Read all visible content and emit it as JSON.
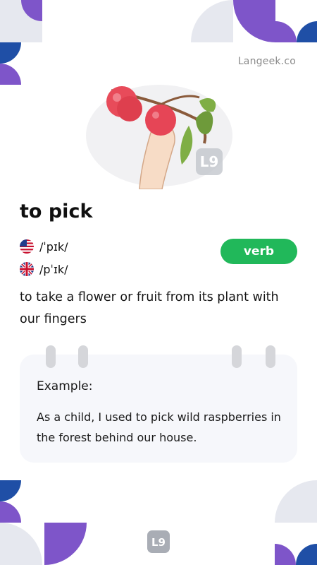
{
  "brand": {
    "site": "Langeek.co"
  },
  "entry": {
    "word": "to pick",
    "pronunciations": [
      {
        "region": "US",
        "flag_icon": "us-flag-icon",
        "ipa": "/ˈpɪk/"
      },
      {
        "region": "UK",
        "flag_icon": "uk-flag-icon",
        "ipa": "/pˈɪk/"
      }
    ],
    "part_of_speech": "verb",
    "definition": "to take a flower or fruit from its plant with our fingers"
  },
  "example": {
    "label": "Example:",
    "sentence": "As a child, I used to pick wild raspberries in the forest behind our house."
  },
  "colors": {
    "accent_purple": "#7e55c9",
    "accent_blue": "#1f4fa6",
    "accent_gray": "#e6e8ef",
    "verb_badge": "#21b85a",
    "card_background": "#f6f7fb"
  }
}
